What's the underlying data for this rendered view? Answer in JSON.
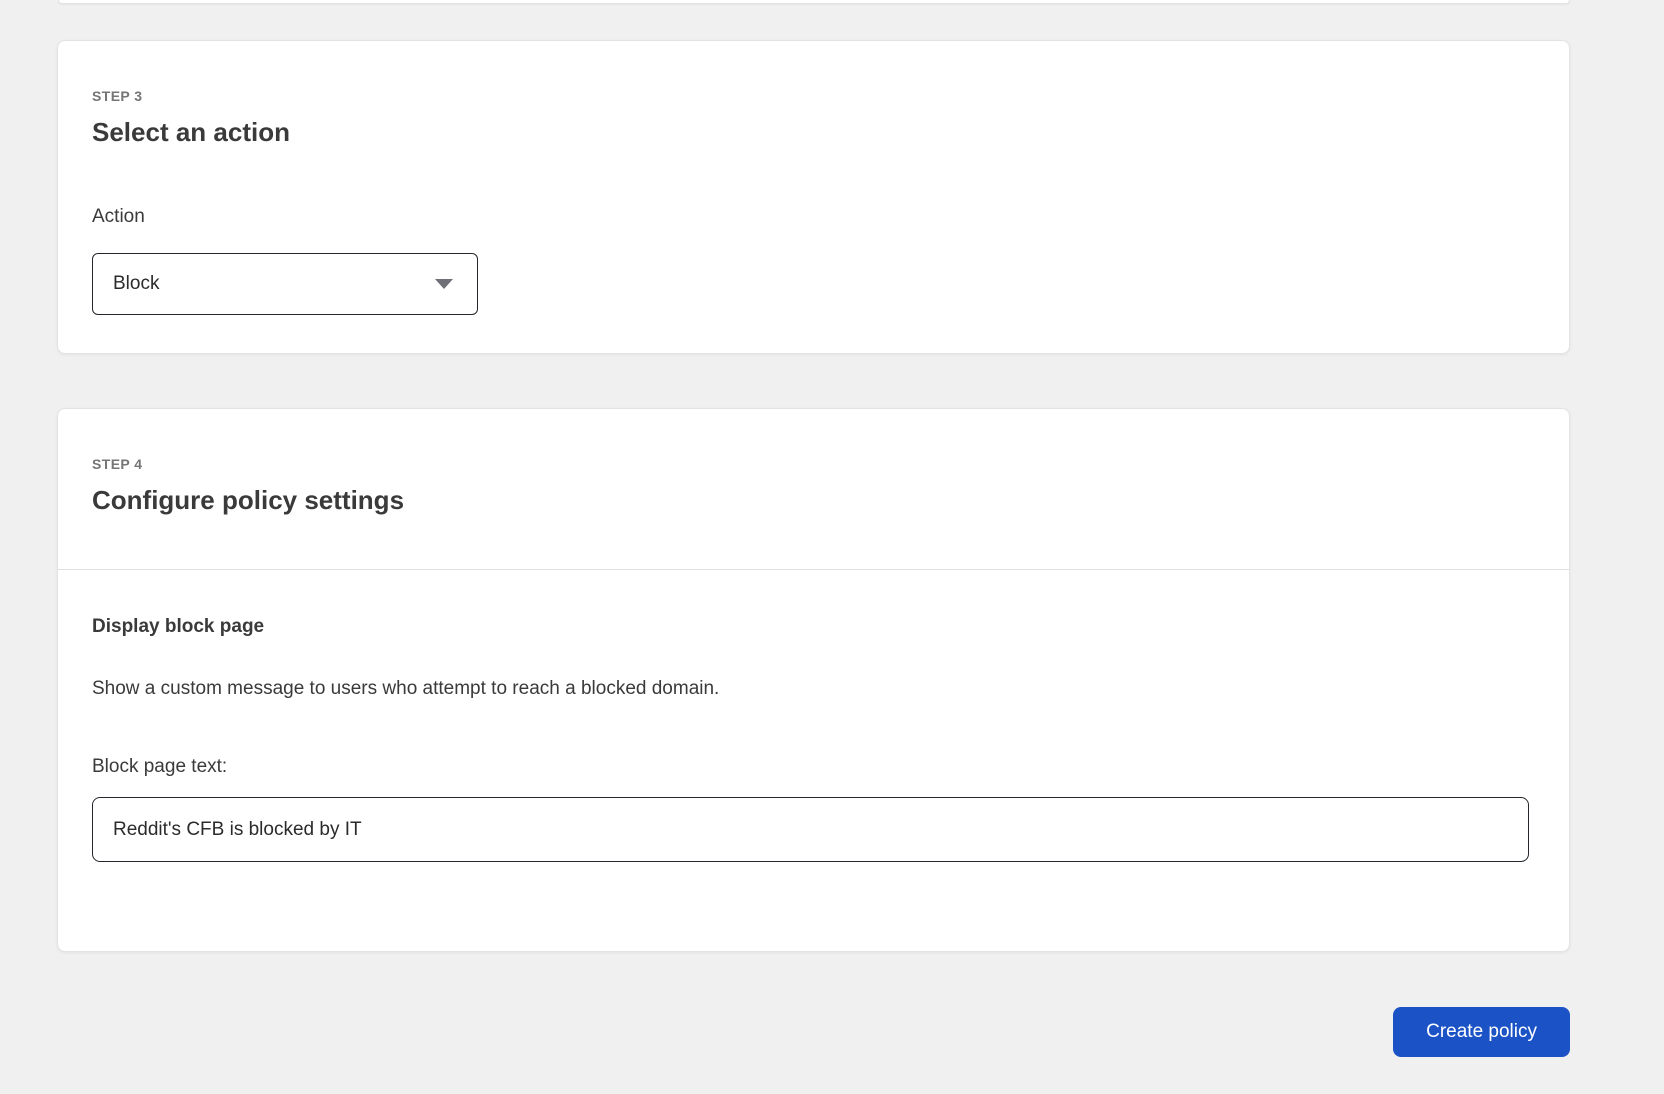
{
  "colors": {
    "page_background": "#f0f0f0",
    "card_background": "#ffffff",
    "card_border": "#e3e3e3",
    "divider": "#e0e0e0",
    "step_label_gray": "#757575",
    "text_dark": "#3a3a3a",
    "control_border": "#23272c",
    "caret_gray": "#6d7177",
    "primary_blue": "#1b53c6",
    "button_text": "#ffffff"
  },
  "step3_card": {
    "step_label": "STEP 3",
    "title": "Select an action",
    "action_field": {
      "label": "Action",
      "selected_value": "Block"
    }
  },
  "step4_card": {
    "step_label": "STEP 4",
    "title": "Configure policy settings",
    "display_block_page": {
      "section_title": "Display block page",
      "description": "Show a custom message to users who attempt to reach a blocked domain.",
      "input_label": "Block page text:",
      "input_value": "Reddit's CFB is blocked by IT"
    }
  },
  "footer": {
    "create_policy_label": "Create policy"
  }
}
